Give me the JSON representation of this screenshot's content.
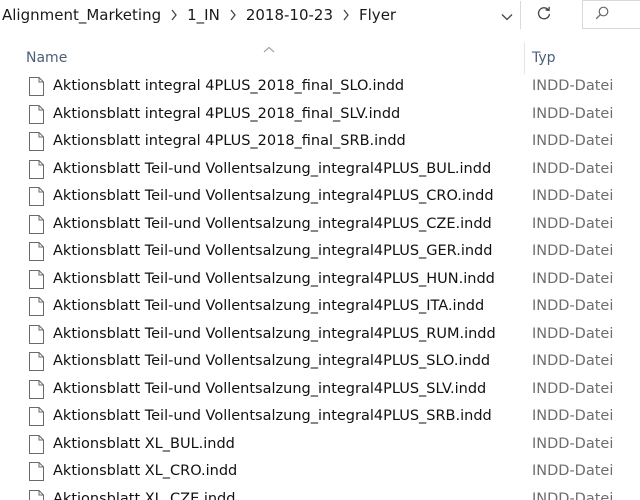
{
  "breadcrumb": {
    "items": [
      "Alignment_Marketing",
      "1_IN",
      "2018-10-23",
      "Flyer"
    ]
  },
  "search": {
    "placeholder": ""
  },
  "columns": {
    "name": "Name",
    "type": "Typ"
  },
  "files": [
    {
      "name": "Aktionsblatt integral 4PLUS_2018_final_SLO.indd",
      "type": "INDD-Datei"
    },
    {
      "name": "Aktionsblatt integral 4PLUS_2018_final_SLV.indd",
      "type": "INDD-Datei"
    },
    {
      "name": "Aktionsblatt integral 4PLUS_2018_final_SRB.indd",
      "type": "INDD-Datei"
    },
    {
      "name": "Aktionsblatt Teil-und Vollentsalzung_integral4PLUS_BUL.indd",
      "type": "INDD-Datei"
    },
    {
      "name": "Aktionsblatt Teil-und Vollentsalzung_integral4PLUS_CRO.indd",
      "type": "INDD-Datei"
    },
    {
      "name": "Aktionsblatt Teil-und Vollentsalzung_integral4PLUS_CZE.indd",
      "type": "INDD-Datei"
    },
    {
      "name": "Aktionsblatt Teil-und Vollentsalzung_integral4PLUS_GER.indd",
      "type": "INDD-Datei"
    },
    {
      "name": "Aktionsblatt Teil-und Vollentsalzung_integral4PLUS_HUN.indd",
      "type": "INDD-Datei"
    },
    {
      "name": "Aktionsblatt Teil-und Vollentsalzung_integral4PLUS_ITA.indd",
      "type": "INDD-Datei"
    },
    {
      "name": "Aktionsblatt Teil-und Vollentsalzung_integral4PLUS_RUM.indd",
      "type": "INDD-Datei"
    },
    {
      "name": "Aktionsblatt Teil-und Vollentsalzung_integral4PLUS_SLO.indd",
      "type": "INDD-Datei"
    },
    {
      "name": "Aktionsblatt Teil-und Vollentsalzung_integral4PLUS_SLV.indd",
      "type": "INDD-Datei"
    },
    {
      "name": "Aktionsblatt Teil-und Vollentsalzung_integral4PLUS_SRB.indd",
      "type": "INDD-Datei"
    },
    {
      "name": "Aktionsblatt XL_BUL.indd",
      "type": "INDD-Datei"
    },
    {
      "name": "Aktionsblatt XL_CRO.indd",
      "type": "INDD-Datei"
    },
    {
      "name": "Aktionsblatt XL_CZE.indd",
      "type": "INDD-Datei"
    }
  ],
  "icons": {
    "breadcrumb_separator": "chevron-right-icon",
    "dropdown": "chevron-down-icon",
    "refresh": "refresh-icon",
    "search": "search-icon",
    "sort": "sort-ascending-icon",
    "file": "document-file-icon"
  },
  "colors": {
    "header_text": "#4c607a",
    "type_text": "#6d6d6d",
    "divider": "#e5e5e5"
  }
}
